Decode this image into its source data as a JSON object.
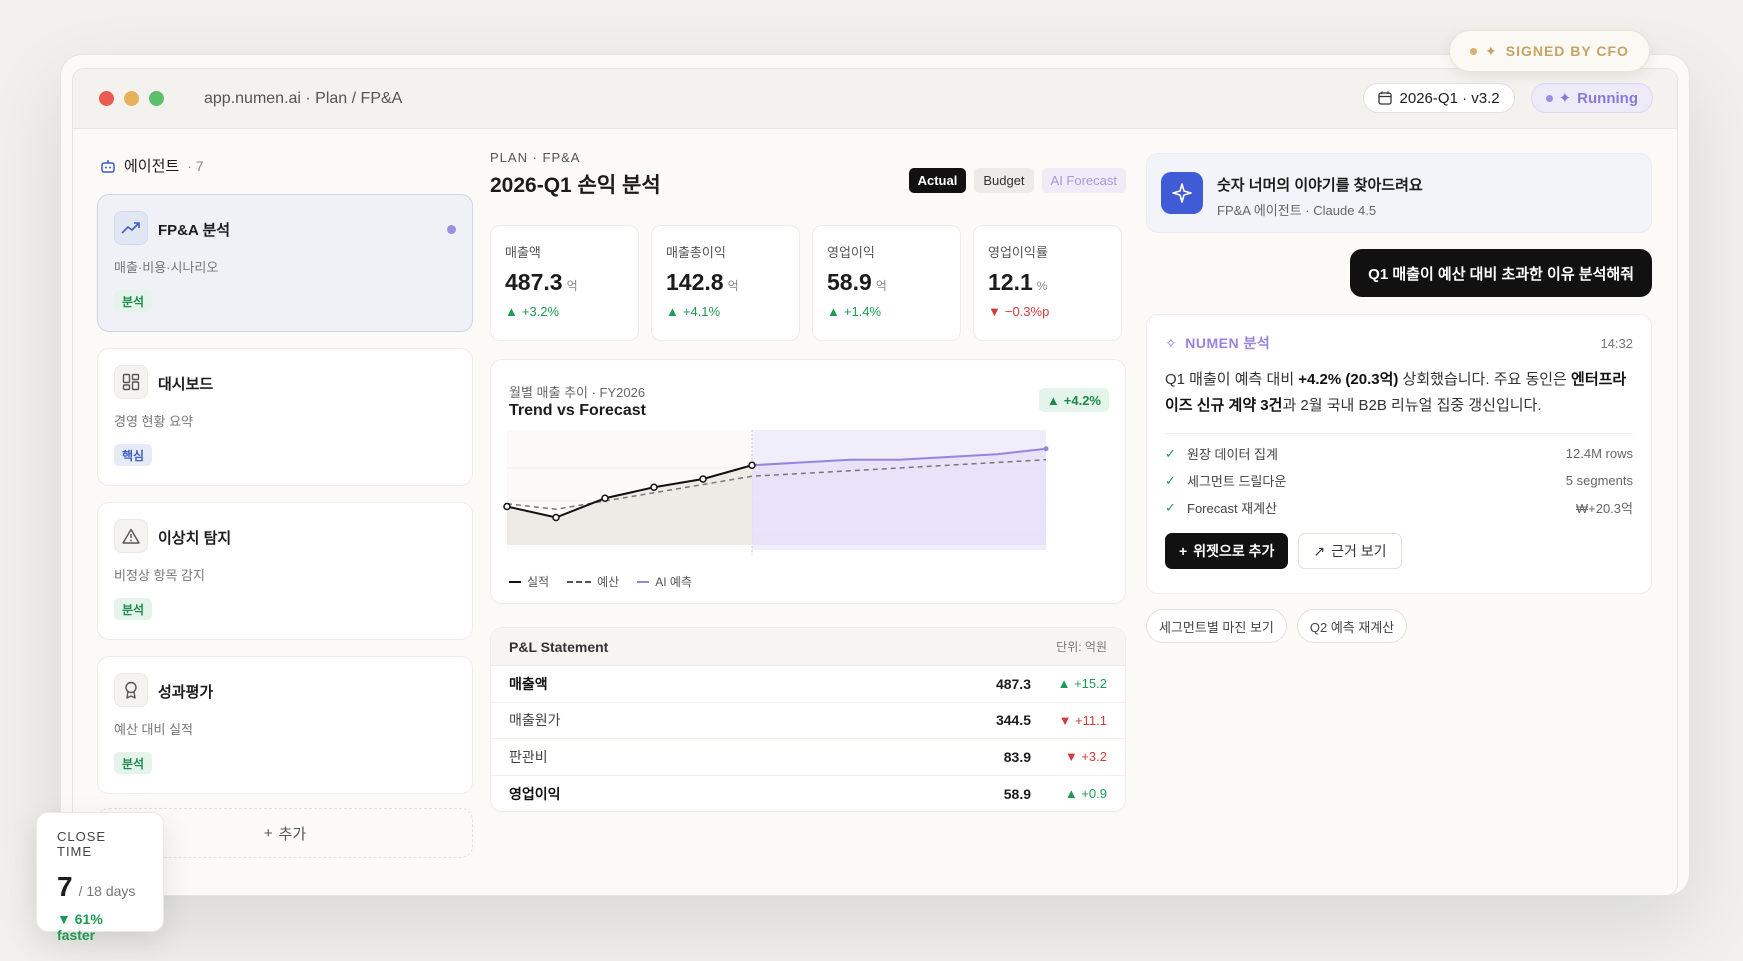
{
  "window": {
    "url": "app.numen.ai · Plan / FP&A",
    "period": "2026-Q1 · v3.2",
    "status": "Running",
    "signed": "SIGNED BY CFO"
  },
  "sidebar": {
    "title": "에이전트",
    "count": "· 7",
    "agents": [
      {
        "name": "FP&A 분석",
        "sub": "매출·비용·시나리오",
        "tag": "분석",
        "icon": "trend-icon"
      },
      {
        "name": "대시보드",
        "sub": "경영 현황 요약",
        "tag": "핵심",
        "icon": "dashboard-icon"
      },
      {
        "name": "이상치 탐지",
        "sub": "비정상 항목 감지",
        "tag": "분석",
        "icon": "warning-icon"
      },
      {
        "name": "성과평가",
        "sub": "예산 대비 실적",
        "tag": "분석",
        "icon": "award-icon"
      }
    ],
    "add_label": "추가"
  },
  "close_time": {
    "label": "CLOSE TIME",
    "value": "7",
    "of": "/ 18 days",
    "faster": "61% faster"
  },
  "main": {
    "crumb": "PLAN · FP&A",
    "title": "2026-Q1 손익 분석",
    "toggles": [
      "Actual",
      "Budget",
      "AI Forecast"
    ],
    "kpis": [
      {
        "label": "매출액",
        "value": "487.3",
        "unit": "억",
        "delta": "+3.2%",
        "dir": "up"
      },
      {
        "label": "매출총이익",
        "value": "142.8",
        "unit": "억",
        "delta": "+4.1%",
        "dir": "up"
      },
      {
        "label": "영업이익",
        "value": "58.9",
        "unit": "억",
        "delta": "+1.4%",
        "dir": "up"
      },
      {
        "label": "영업이익률",
        "value": "12.1",
        "unit": "%",
        "delta": "−0.3%p",
        "dir": "down"
      }
    ],
    "trend": {
      "subtitle": "월별 매출 추이 · FY2026",
      "title": "Trend vs Forecast",
      "badge": "+4.2%",
      "legend": [
        "실적",
        "예산",
        "AI 예측"
      ]
    },
    "pl": {
      "title": "P&L Statement",
      "unit": "단위: 억원",
      "rows": [
        {
          "name": "매출액",
          "value": "487.3",
          "change": "+15.2",
          "dir": "up",
          "bold": true
        },
        {
          "name": "매출원가",
          "value": "344.5",
          "change": "+11.1",
          "dir": "down",
          "bold": false
        },
        {
          "name": "판관비",
          "value": "83.9",
          "change": "+3.2",
          "dir": "down",
          "bold": false
        },
        {
          "name": "영업이익",
          "value": "58.9",
          "change": "+0.9",
          "dir": "up",
          "bold": true
        }
      ]
    }
  },
  "chart_data": {
    "type": "line",
    "title": "Trend vs Forecast",
    "subtitle": "월별 매출 추이 · FY2026",
    "series": [
      {
        "name": "실적",
        "values": [
          0.78,
          0.7,
          0.84,
          0.92,
          0.98,
          1.08
        ]
      },
      {
        "name": "예산",
        "values": [
          0.8,
          0.76,
          0.82,
          0.88,
          0.94,
          1.0,
          1.02,
          1.04,
          1.06,
          1.08,
          1.1,
          1.12
        ]
      },
      {
        "name": "AI 예측",
        "values": [
          null,
          null,
          null,
          null,
          null,
          1.08,
          1.1,
          1.12,
          1.12,
          1.14,
          1.16,
          1.2
        ]
      }
    ],
    "ylim": [
      0.5,
      1.3
    ],
    "grid": true
  },
  "assistant": {
    "hero_title": "숫자 너머의 이야기를 찾아드려요",
    "hero_sub": "FP&A 에이전트 · Claude 4.5",
    "user_msg": "Q1 매출이 예산 대비 초과한 이유 분석해줘",
    "brand": "NUMEN 분석",
    "time": "14:32",
    "body_1": "Q1 매출이 예측 대비 ",
    "body_2": "+4.2% (20.3억)",
    "body_3": " 상회했습니다. 주요 동인은 ",
    "body_4": "엔터프라이즈 신규 계약 3건",
    "body_5": "과 2월 국내 B2B 리뉴얼 집중 갱신입니다.",
    "checks": [
      {
        "label": "원장 데이터 집계",
        "value": "12.4M rows"
      },
      {
        "label": "세그먼트 드릴다운",
        "value": "5 segments"
      },
      {
        "label": "Forecast 재계산",
        "value": "₩+20.3억"
      }
    ],
    "add_widget": "위젯으로 추가",
    "evidence": "근거 보기",
    "suggestions": [
      "세그먼트별 마진 보기",
      "Q2 예측 재계산"
    ]
  },
  "colors": {
    "accent": "#3f5bd6",
    "ai": "#9684e0",
    "up": "#1d9a55",
    "down": "#d63a3a"
  }
}
